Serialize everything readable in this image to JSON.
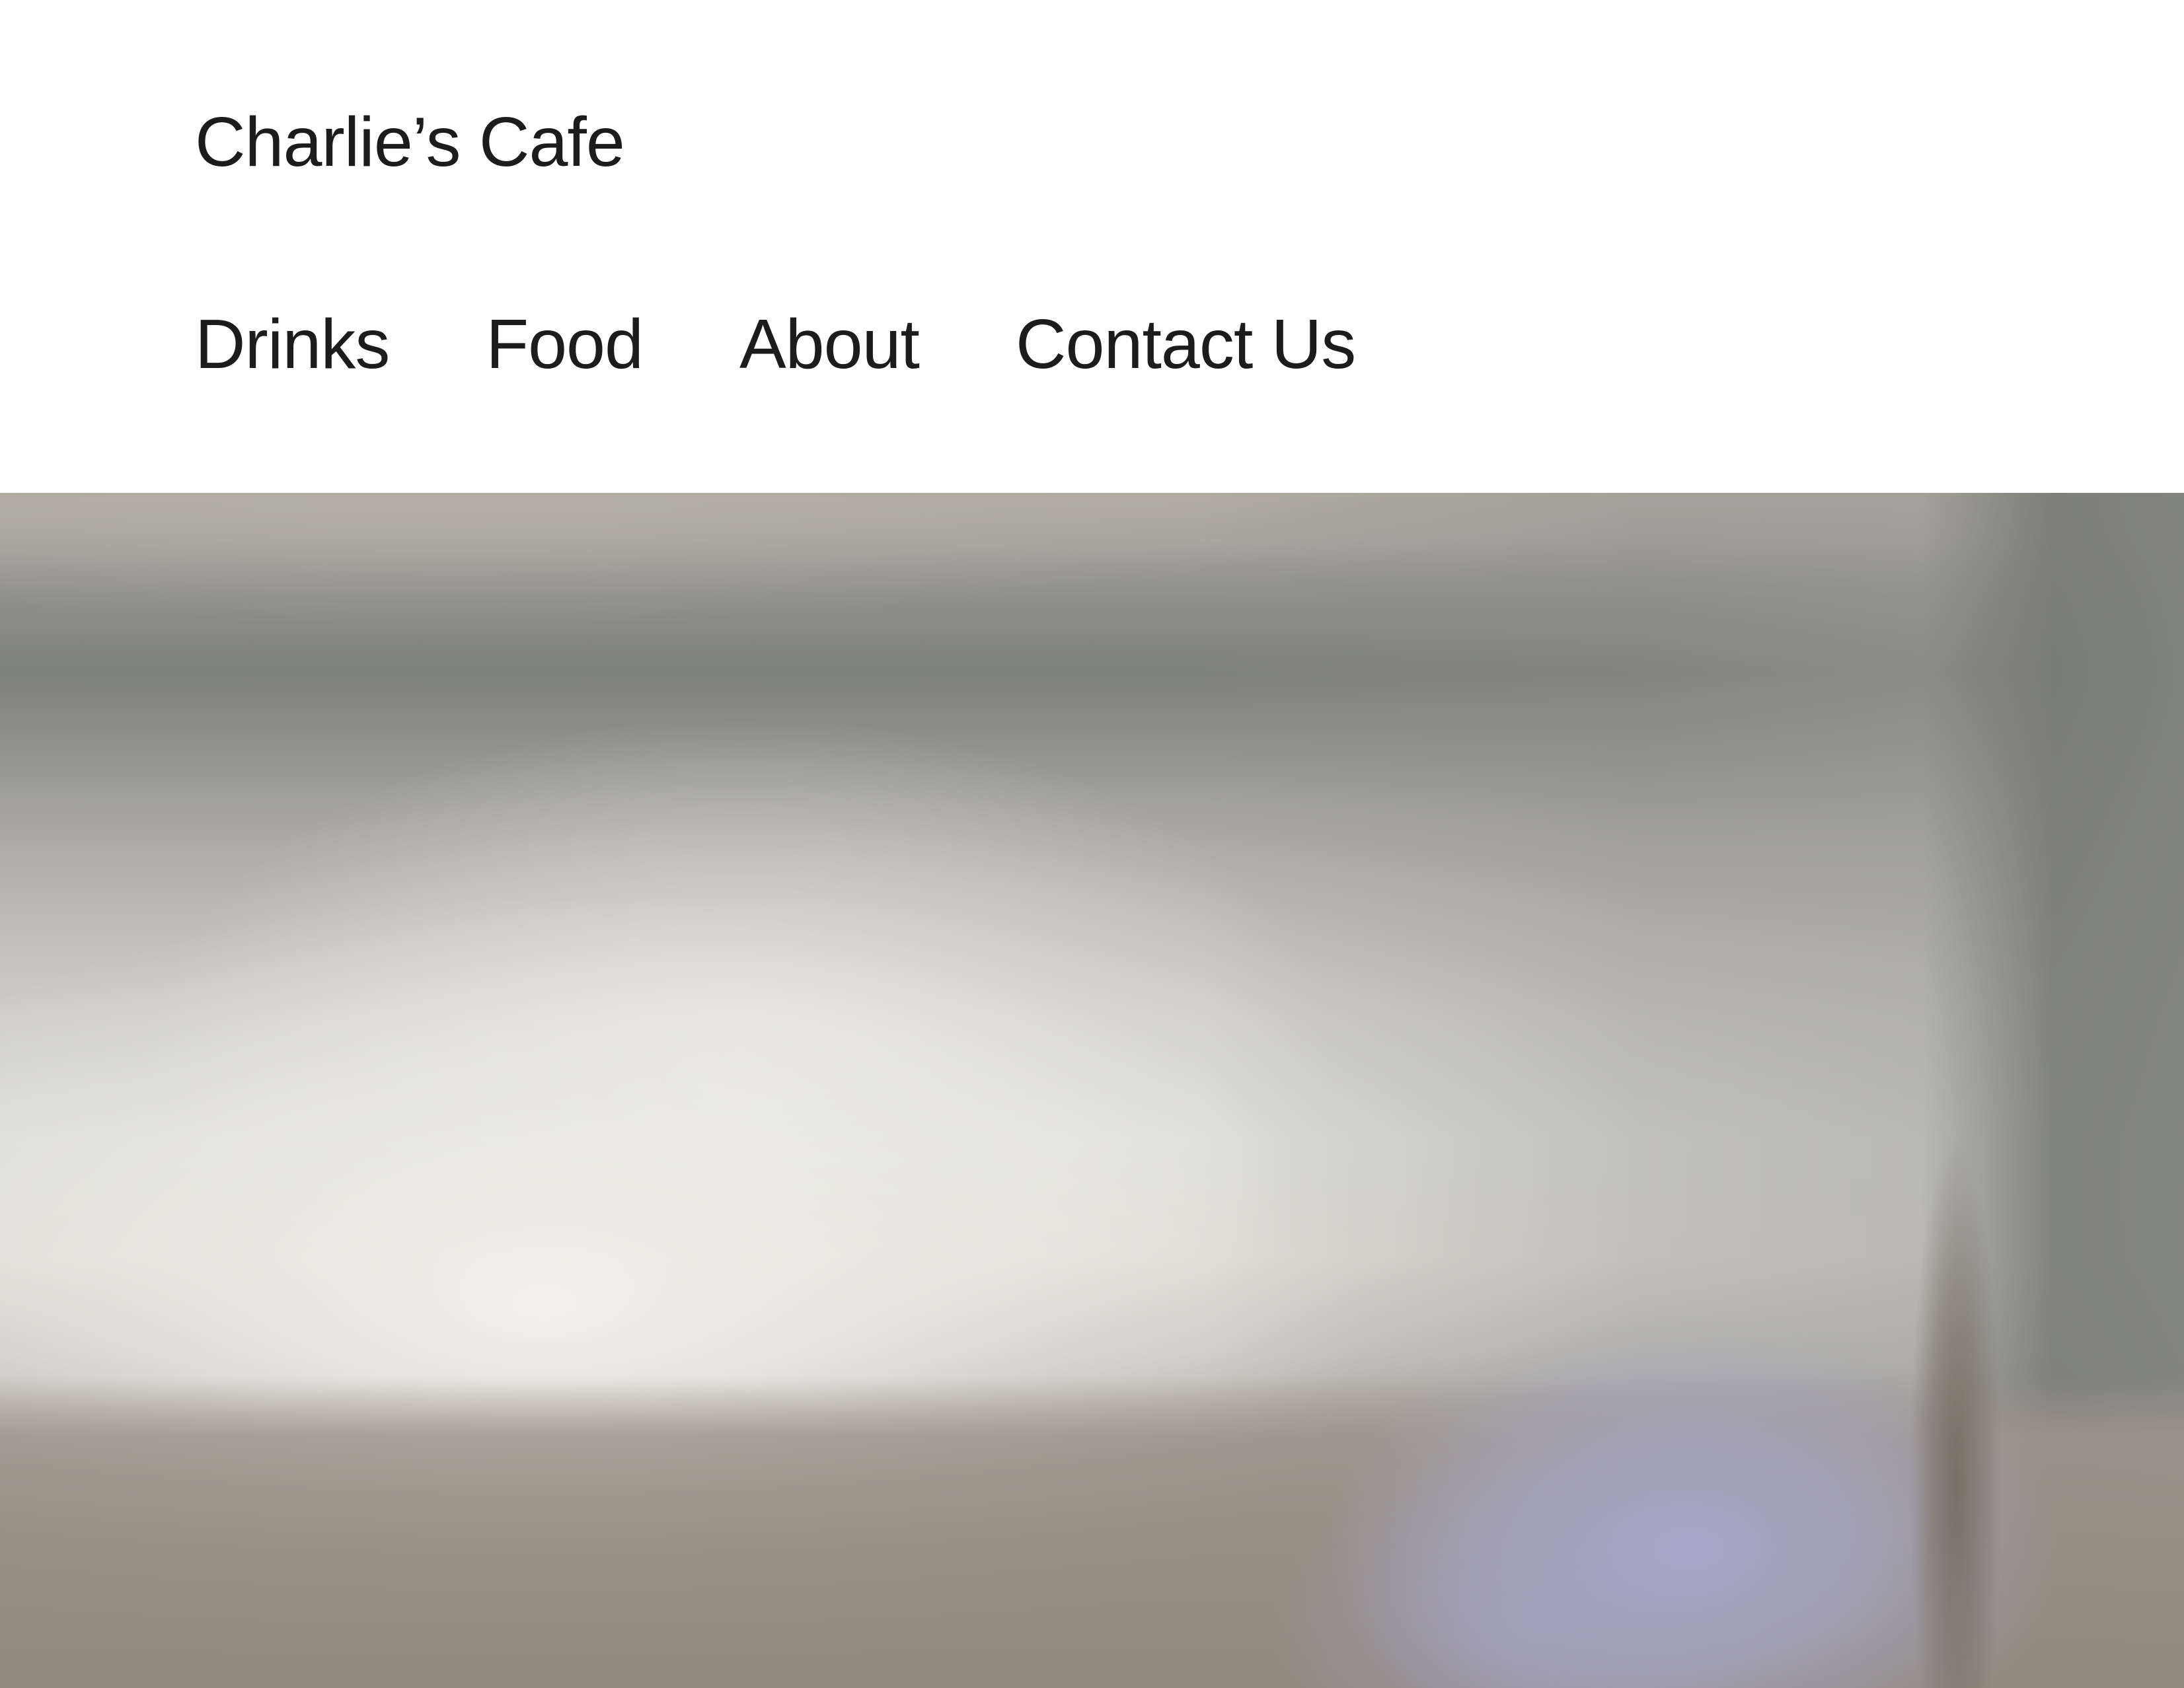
{
  "site": {
    "title": "Charlie’s Cafe"
  },
  "nav": {
    "items": [
      {
        "label": "Drinks"
      },
      {
        "label": "Food"
      },
      {
        "label": "About"
      },
      {
        "label": "Contact Us"
      }
    ]
  },
  "colors": {
    "background": "#ffffff",
    "text": "#1c1c1c",
    "hero_tone": "#a8a69e"
  },
  "hero": {
    "image_semantic": "blurred-cafe-interior-photo"
  }
}
